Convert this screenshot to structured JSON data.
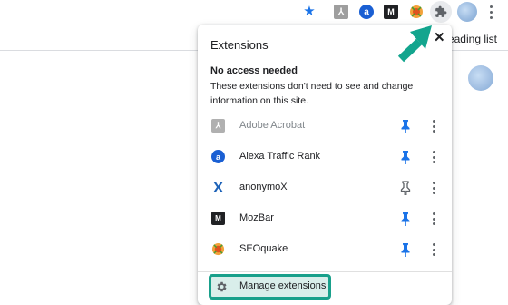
{
  "toolbar": {
    "icons": [
      "star-icon",
      "adobe-acrobat-icon",
      "alexa-icon",
      "mozbar-icon",
      "seoquake-icon",
      "puzzle-icon",
      "avatar",
      "more-vert-icon"
    ],
    "reading_list": "Reading list"
  },
  "popup": {
    "title": "Extensions",
    "close_symbol": "✕",
    "section_title": "No access needed",
    "section_desc": "These extensions don't need to see and change information on this site.",
    "extensions": [
      {
        "name": "Adobe Acrobat",
        "icon": "adobe-acrobat-icon",
        "pinned": true,
        "dimmed": true
      },
      {
        "name": "Alexa Traffic Rank",
        "icon": "alexa-icon",
        "pinned": true
      },
      {
        "name": "anonymoX",
        "icon": "anonymox-icon",
        "pinned": false
      },
      {
        "name": "MozBar",
        "icon": "mozbar-icon",
        "pinned": true
      },
      {
        "name": "SEOquake",
        "icon": "seoquake-icon",
        "pinned": true
      }
    ],
    "manage_label": "Manage extensions"
  },
  "colors": {
    "pin_blue": "#1a73e8",
    "highlight_teal": "#19a08b",
    "highlight_fill": "#d9eeea"
  }
}
